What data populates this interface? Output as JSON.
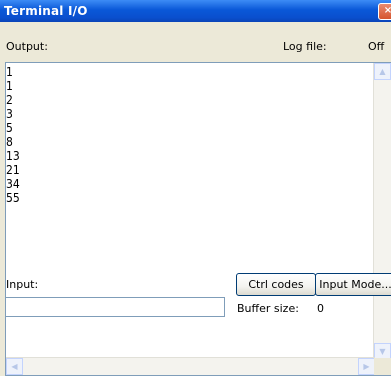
{
  "window": {
    "title": "Terminal I/O",
    "close_glyph": "×"
  },
  "output": {
    "label": "Output:",
    "log_file_label": "Log file:",
    "log_file_value": "Off",
    "lines": [
      "1",
      "1",
      "2",
      "3",
      "5",
      "8",
      "13",
      "21",
      "34",
      "55"
    ]
  },
  "input": {
    "label": "Input:",
    "value": "",
    "ctrl_codes_label": "Ctrl codes",
    "input_mode_label": "Input Mode...",
    "buffer_size_label": "Buffer size:",
    "buffer_size_value": "0"
  },
  "icons": {
    "scroll_up": "▲",
    "scroll_down": "▼",
    "scroll_left": "◀",
    "scroll_right": "▶"
  }
}
